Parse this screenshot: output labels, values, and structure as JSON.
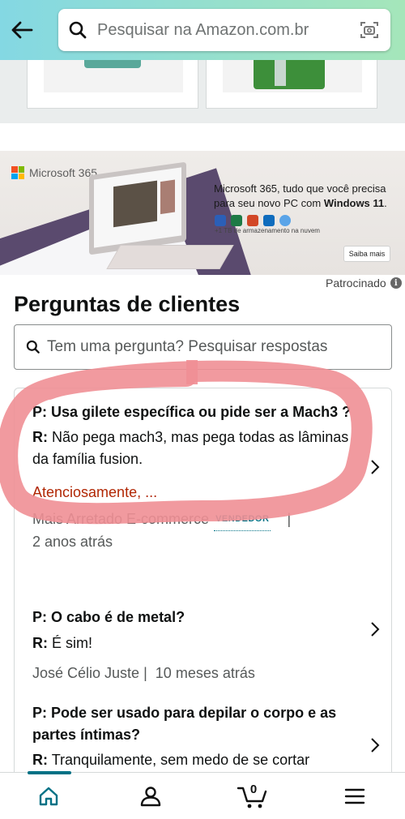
{
  "header": {
    "search_placeholder": "Pesquisar na Amazon.com.br",
    "icons": [
      "back-arrow-icon",
      "search-icon",
      "camera-scan-icon"
    ],
    "gradient_colors": [
      "#84d8e3",
      "#a5e6ba"
    ]
  },
  "ad": {
    "brand": "Microsoft 365",
    "headline_pre": "Microsoft 365, tudo que você precisa para seu novo PC com ",
    "headline_bold": "Windows 11",
    "headline_post": ".",
    "storage_note": "+1 TB de armazenamento na nuvem",
    "cta_label": "Saiba mais",
    "sponsored_label": "Patrocinado"
  },
  "qa": {
    "title": "Perguntas de clientes",
    "search_placeholder": "Tem uma pergunta? Pesquisar respostas",
    "items": [
      {
        "q_label": "P:",
        "question": "Usa gilete específica ou pide ser a Mach3 ?",
        "a_label": "R:",
        "answer": "Não pega mach3, mas pega todas as lâminas da família fusion.",
        "answer_more": "Atenciosamente, ...",
        "author": "Mais Arretado E-commerce",
        "badge": "VENDEDOR",
        "separator": "|",
        "time": "2 anos atrás"
      },
      {
        "q_label": "P:",
        "question": "O cabo é de metal?",
        "a_label": "R:",
        "answer": "É sim!",
        "author": "José Célio Juste",
        "separator": "|",
        "time": "10 meses atrás"
      },
      {
        "q_label": "P:",
        "question": "Pode ser usado para depilar o corpo e as partes íntimas?",
        "a_label": "R:",
        "answer": "Tranquilamente, sem medo de se cortar"
      }
    ]
  },
  "bottom_nav": {
    "cart_count": "0",
    "icons": [
      "home-icon",
      "account-icon",
      "cart-icon",
      "menu-icon"
    ],
    "active_color": "#007185"
  },
  "annotation_color": "#f08f95"
}
